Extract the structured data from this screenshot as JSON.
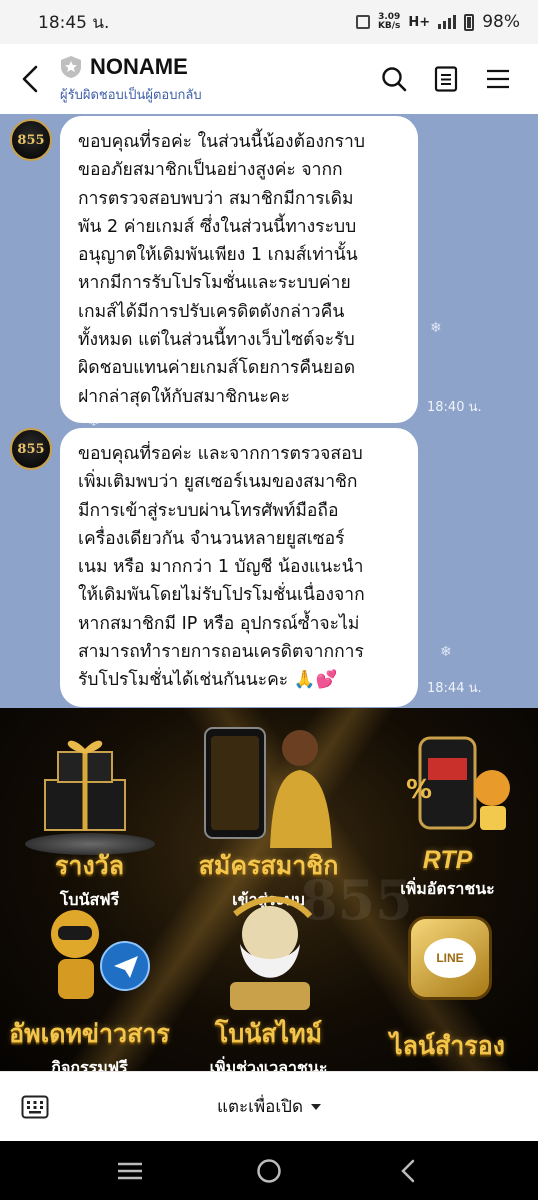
{
  "status_bar": {
    "time": "18:45 น.",
    "net_speed_value": "3.09",
    "net_speed_unit": "KB/s",
    "network": "H+",
    "battery": "98%"
  },
  "header": {
    "title": "NONAME",
    "subtitle": "ผู้รับผิดชอบเป็นผู้ตอบกลับ",
    "icons": [
      "back-icon",
      "shield-icon",
      "search-icon",
      "notes-icon",
      "menu-icon"
    ]
  },
  "messages": [
    {
      "avatar_text": "855",
      "lines": [
        "ขอบคุณที่รอค่ะ ในส่วนนี้น้องต้องกราบ",
        "ขออภัยสมาชิกเป็นอย่างสูงค่ะ จากก",
        "การตรวจสอบพบว่า สมาชิกมีการเดิม",
        "พัน 2 ค่ายเกมส์ ซึ่งในส่วนนี้ทางระบบ",
        "อนุญาตให้เดิมพันเพียง 1 เกมส์เท่านั้น",
        "หากมีการรับโปรโมชั่นและระบบค่าย",
        "เกมส์ได้มีการปรับเครดิตดังกล่าวคืน",
        "ทั้งหมด แต่ในส่วนนี้ทางเว็บไซต์จะรับ",
        "ผิดชอบแทนค่ายเกมส์โดยการคืนยอด",
        "ฝากล่าสุดให้กับสมาชิกนะคะ"
      ],
      "time": "18:40 น."
    },
    {
      "avatar_text": "855",
      "lines": [
        "ขอบคุณที่รอค่ะ และจากการตรวจสอบ",
        "เพิ่มเติมพบว่า ยูสเซอร์เนมของสมาชิก",
        "มีการเข้าสู่ระบบผ่านโทรศัพท์มือถือ",
        "เครื่องเดียวกัน จำนวนหลายยูสเซอร์",
        "เนม หรือ มากกว่า 1 บัญชี น้องแนะนำ",
        "ให้เดิมพันโดยไม่รับโปรโมชั่นเนื่องจาก",
        "หากสมาชิกมี IP หรือ อุปกรณ์ซ้ำจะไม่",
        "สามารถทำรายการถอนเครดิตจากการ",
        "รับโปรโมชั่นได้เช่นกันนะคะ 🙏💕"
      ],
      "time": "18:44 น."
    }
  ],
  "banner": {
    "watermark": "855",
    "tiles": [
      {
        "title": "รางวัล",
        "sub": "โบนัสฟรี"
      },
      {
        "title": "สมัครสมาชิก",
        "sub": "เข้าสู่ระบบ"
      },
      {
        "title": "RTP",
        "sub": "เพิ่มอัตราชนะ"
      },
      {
        "title": "อัพเดทข่าวสาร",
        "sub": "กิจกรรมฟรี"
      },
      {
        "title": "โบนัสไทม์",
        "sub": "เพิ่มช่วงเวลาชนะ"
      },
      {
        "title": "ไลน์สำรอง",
        "sub": ""
      }
    ],
    "line_badge": "LINE"
  },
  "bottom_bar": {
    "open_label": "แตะเพื่อเปิด"
  },
  "colors": {
    "chat_bg": "#8ea3c9",
    "gold": "#f3c64b",
    "subtitle_blue": "#3d5fa8"
  }
}
